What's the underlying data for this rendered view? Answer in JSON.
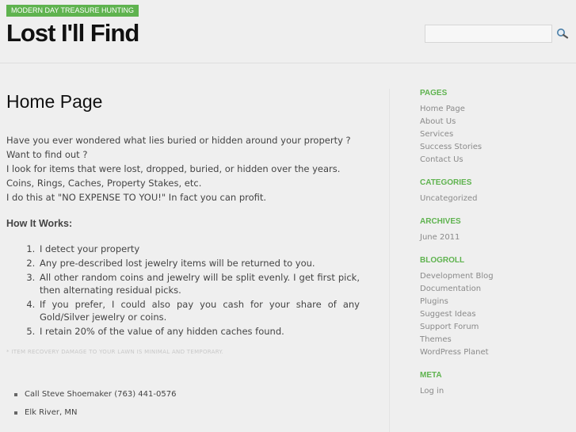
{
  "header": {
    "tagline": "MODERN DAY TREASURE HUNTING",
    "site_title": "Lost I'll Find",
    "search": {
      "value": "",
      "placeholder": ""
    },
    "search_icon": "magnifier-icon"
  },
  "main": {
    "page_title": "Home Page",
    "intro": [
      "Have you ever wondered what lies buried or hidden around your property ?",
      "Want to find out ?",
      "I look for items that were lost, dropped, buried, or hidden over the years.",
      "Coins, Rings, Caches, Property Stakes, etc.",
      "I do this at \"NO EXPENSE TO YOU!\" In fact you can profit."
    ],
    "how_heading": "How It Works:",
    "steps": [
      "I detect your property",
      "Any pre-described lost jewelry items will be returned to you.",
      "All other random coins and jewelry will be split evenly. I get first pick, then alternating residual picks.",
      "If you prefer, I could also pay you cash for your share of any Gold/Silver jewelry or coins.",
      "I retain 20% of the value of any hidden caches found."
    ],
    "footnote": "* ITEM RECOVERY DAMAGE TO YOUR LAWN IS MINIMAL AND TEMPORARY.",
    "contact": [
      "Call Steve Shoemaker (763) 441-0576",
      "Elk River, MN"
    ]
  },
  "sidebar": {
    "pages": {
      "title": "PAGES",
      "items": [
        "Home Page",
        "About Us",
        "Services",
        "Success Stories",
        "Contact Us"
      ]
    },
    "categories": {
      "title": "CATEGORIES",
      "items": [
        "Uncategorized"
      ]
    },
    "archives": {
      "title": "ARCHIVES",
      "items": [
        "June 2011"
      ]
    },
    "blogroll": {
      "title": "BLOGROLL",
      "items": [
        "Development Blog",
        "Documentation",
        "Plugins",
        "Suggest Ideas",
        "Support Forum",
        "Themes",
        "WordPress Planet"
      ]
    },
    "meta": {
      "title": "META",
      "items": [
        "Log in"
      ]
    }
  },
  "colors": {
    "accent": "#5fb34f",
    "background": "#efefef",
    "sidebar_link": "#8a8a8a"
  }
}
